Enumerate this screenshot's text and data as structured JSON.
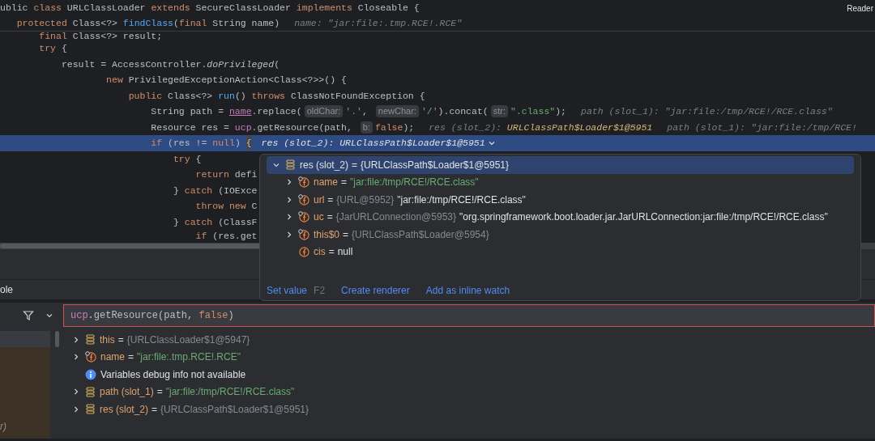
{
  "editor": {
    "reader_mode": "Reader",
    "sticky_lines": [
      {
        "tokens": [
          {
            "kind": "plain",
            "s": "ublic "
          },
          {
            "kind": "kw",
            "s": "class "
          },
          {
            "kind": "plain",
            "s": "URLClassLoader "
          },
          {
            "kind": "kw",
            "s": "extends "
          },
          {
            "kind": "plain",
            "s": "SecureClassLoader "
          },
          {
            "kind": "kw",
            "s": "implements "
          },
          {
            "kind": "plain",
            "s": "Closeable {"
          }
        ]
      },
      {
        "tokens": [
          {
            "kind": "kw",
            "s": "   protected "
          },
          {
            "kind": "plain",
            "s": "Class<?> "
          },
          {
            "kind": "fn",
            "s": "findClass"
          },
          {
            "kind": "plain",
            "s": "("
          },
          {
            "kind": "kw",
            "s": "final "
          },
          {
            "kind": "plain",
            "s": "String name)"
          },
          {
            "kind": "inline",
            "s": "name: \"jar:file:.tmp.RCE!.RCE\""
          }
        ]
      }
    ],
    "code_lines": [
      {
        "selected": false,
        "tokens": [
          {
            "kind": "kw",
            "s": "       final "
          },
          {
            "kind": "plain",
            "s": "Class<?> result;"
          }
        ]
      },
      {
        "selected": false,
        "tokens": [
          {
            "kind": "kw",
            "s": "       try"
          },
          {
            "kind": "plain",
            "s": " {"
          }
        ]
      },
      {
        "selected": false,
        "tokens": [
          {
            "kind": "plain",
            "s": "           result = AccessController."
          },
          {
            "kind": "ital",
            "s": "doPrivileged"
          },
          {
            "kind": "plain",
            "s": "("
          }
        ]
      },
      {
        "selected": false,
        "tokens": [
          {
            "kind": "kw",
            "s": "                   new "
          },
          {
            "kind": "plain",
            "s": "PrivilegedExceptionAction<Class<?>>() {"
          }
        ]
      },
      {
        "selected": false,
        "tokens": [
          {
            "kind": "kw",
            "s": "                       public "
          },
          {
            "kind": "plain",
            "s": "Class<?> "
          },
          {
            "kind": "fn",
            "s": "run"
          },
          {
            "kind": "plain",
            "s": "() "
          },
          {
            "kind": "kw",
            "s": "throws "
          },
          {
            "kind": "plain",
            "s": "ClassNotFoundException {"
          }
        ]
      },
      {
        "selected": false,
        "tokens": [
          {
            "kind": "plain",
            "s": "                           String path = "
          },
          {
            "kind": "param",
            "s": "name"
          },
          {
            "kind": "plain",
            "s": ".replace("
          },
          {
            "kind": "hint",
            "s": "oldChar:"
          },
          {
            "kind": "str",
            "s": "'.'"
          },
          {
            "kind": "plain",
            "s": ", "
          },
          {
            "kind": "hint",
            "s": "newChar:"
          },
          {
            "kind": "str",
            "s": "'/'"
          },
          {
            "kind": "plain",
            "s": ").concat("
          },
          {
            "kind": "hint",
            "s": "str:"
          },
          {
            "kind": "str",
            "s": "\".class\""
          },
          {
            "kind": "plain",
            "s": ");"
          },
          {
            "kind": "inline",
            "s": "path (slot_1): \"jar:file:/tmp/RCE!/RCE.class\""
          }
        ]
      },
      {
        "selected": false,
        "tokens": [
          {
            "kind": "plain",
            "s": "                           Resource res = "
          },
          {
            "kind": "field",
            "s": "ucp"
          },
          {
            "kind": "plain",
            "s": ".getResource(path, "
          },
          {
            "kind": "hint",
            "s": "b:"
          },
          {
            "kind": "kw",
            "s": "false"
          },
          {
            "kind": "plain",
            "s": ");"
          },
          {
            "kind": "inline",
            "s": "res (slot_2): "
          },
          {
            "kind": "inline_val",
            "s": "URLClassPath$Loader$1@5951"
          },
          {
            "kind": "inline",
            "s": "path (slot_1): \"jar:file:/tmp/RCE!"
          }
        ]
      },
      {
        "selected": true,
        "tokens": [
          {
            "kind": "kw",
            "s": "                           if "
          },
          {
            "kind": "plain",
            "s": "(res != "
          },
          {
            "kind": "kw",
            "s": "null"
          },
          {
            "kind": "plain",
            "s": ") "
          },
          {
            "kind": "brace",
            "s": "{"
          },
          {
            "kind": "inline_sel",
            "s": "res (slot_2): URLClassPath$Loader$1@5951"
          }
        ]
      },
      {
        "selected": false,
        "tokens": [
          {
            "kind": "kw",
            "s": "                               try"
          },
          {
            "kind": "plain",
            "s": " {"
          }
        ]
      },
      {
        "selected": false,
        "tokens": [
          {
            "kind": "kw",
            "s": "                                   return "
          },
          {
            "kind": "plain",
            "s": "defi"
          }
        ]
      },
      {
        "selected": false,
        "tokens": [
          {
            "kind": "plain",
            "s": "                               } "
          },
          {
            "kind": "kw",
            "s": "catch "
          },
          {
            "kind": "plain",
            "s": "(IOExce"
          }
        ]
      },
      {
        "selected": false,
        "tokens": [
          {
            "kind": "kw",
            "s": "                                   throw new "
          },
          {
            "kind": "plain",
            "s": "C"
          }
        ]
      },
      {
        "selected": false,
        "tokens": [
          {
            "kind": "plain",
            "s": "                               } "
          },
          {
            "kind": "kw",
            "s": "catch "
          },
          {
            "kind": "plain",
            "s": "(ClassF"
          }
        ]
      },
      {
        "selected": false,
        "tokens": [
          {
            "kind": "kw",
            "s": "                                   if "
          },
          {
            "kind": "plain",
            "s": "(res.get"
          }
        ]
      }
    ]
  },
  "popup": {
    "rows": [
      {
        "selected": true,
        "expanded": true,
        "kind": "local",
        "name": "res (slot_2)",
        "operator": "=",
        "value": "{URLClassPath$Loader$1@5951}",
        "children": [
          {
            "selected": false,
            "expanded": false,
            "kind": "final_field",
            "name": "name",
            "operator": "=",
            "string": "\"jar:file:/tmp/RCE!/RCE.class\""
          },
          {
            "selected": false,
            "expanded": false,
            "kind": "final_field",
            "name": "url",
            "operator": "=",
            "ref": "{URL@5952}",
            "value": "\"jar:file:/tmp/RCE!/RCE.class\""
          },
          {
            "selected": false,
            "expanded": false,
            "kind": "final_field",
            "name": "uc",
            "operator": "=",
            "ref": "{JarURLConnection@5953}",
            "value": "\"org.springframework.boot.loader.jar.JarURLConnection:jar:file:/tmp/RCE!/RCE.class\""
          },
          {
            "selected": false,
            "expanded": false,
            "kind": "final_field",
            "name": "this$0",
            "operator": "=",
            "ref": "{URLClassPath$Loader@5954}"
          },
          {
            "selected": false,
            "kind": "field",
            "name": "cis",
            "operator": "=",
            "value": "null"
          }
        ]
      }
    ],
    "actions": [
      {
        "label": "Set value",
        "shortcut": "F2"
      },
      {
        "label": "Create renderer"
      },
      {
        "label": "Add as inline watch"
      }
    ]
  },
  "debugger": {
    "tab": "ole",
    "frame_text": "r)",
    "expression": [
      {
        "kind": "field",
        "s": "ucp"
      },
      {
        "kind": "plain",
        "s": ".getResource(path, "
      },
      {
        "kind": "kw",
        "s": "false"
      },
      {
        "kind": "plain",
        "s": ")"
      }
    ],
    "variables": [
      {
        "expanded": false,
        "kind": "local",
        "name": "this",
        "operator": "=",
        "ref": "{URLClassLoader$1@5947}"
      },
      {
        "expanded": false,
        "kind": "final_field",
        "name": "name",
        "operator": "=",
        "string": "\"jar:file:.tmp.RCE!.RCE\""
      },
      {
        "kind": "info",
        "message": "Variables debug info not available"
      },
      {
        "expanded": false,
        "kind": "local",
        "name": "path (slot_1)",
        "operator": "=",
        "string": "\"jar:file:/tmp/RCE!/RCE.class\""
      },
      {
        "expanded": false,
        "kind": "local",
        "name": "res (slot_2)",
        "operator": "=",
        "ref": "{URLClassPath$Loader$1@5951}"
      }
    ]
  }
}
